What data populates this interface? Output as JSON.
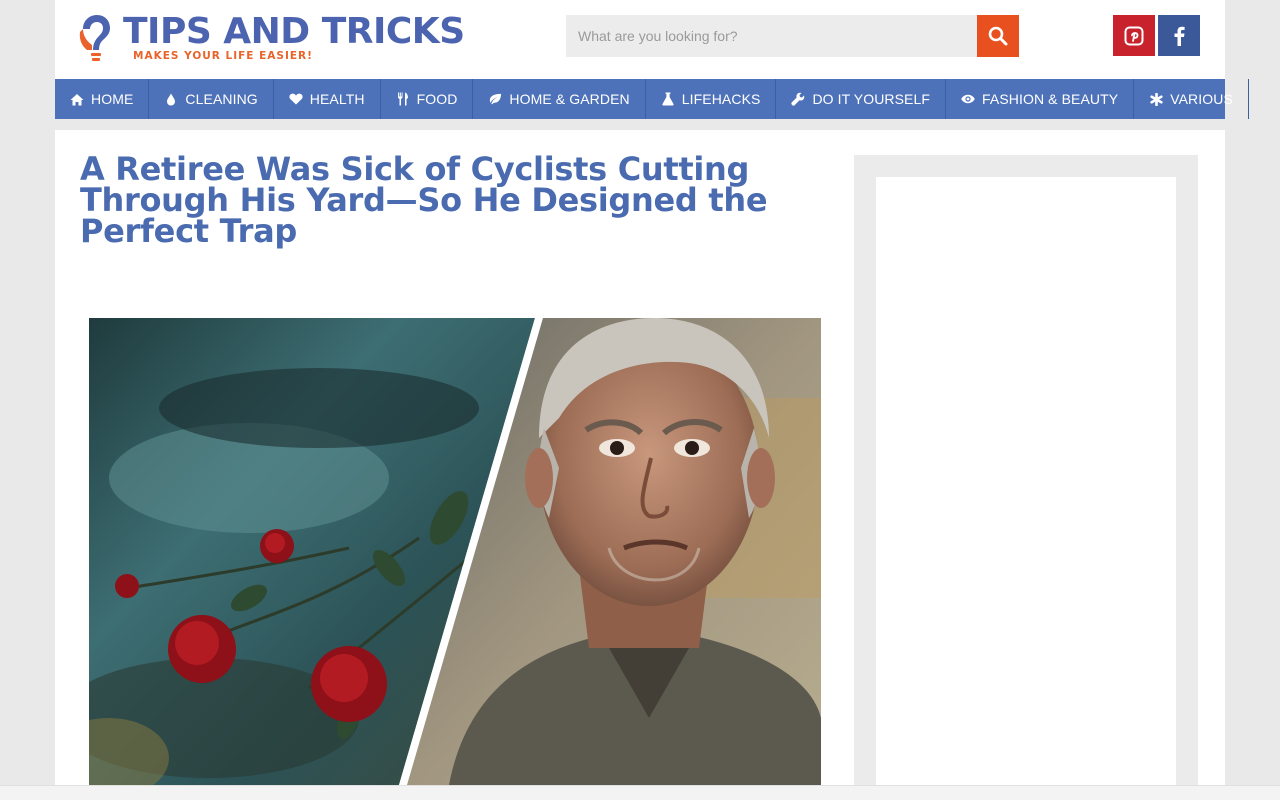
{
  "logo": {
    "title": "TIPS AND TRICKS",
    "tagline": "MAKES YOUR LIFE EASIER!"
  },
  "search": {
    "placeholder": "What are you looking for?"
  },
  "social": [
    {
      "name": "pinterest-icon"
    },
    {
      "name": "facebook-icon"
    }
  ],
  "nav": {
    "items": [
      {
        "label": "HOME",
        "icon": "home-icon"
      },
      {
        "label": "CLEANING",
        "icon": "drop-icon"
      },
      {
        "label": "HEALTH",
        "icon": "heart-icon"
      },
      {
        "label": "FOOD",
        "icon": "cutlery-icon"
      },
      {
        "label": "HOME & GARDEN",
        "icon": "leaf-icon"
      },
      {
        "label": "LIFEHACKS",
        "icon": "flask-icon"
      },
      {
        "label": "DO IT YOURSELF",
        "icon": "wrench-icon"
      },
      {
        "label": "FASHION & BEAUTY",
        "icon": "eye-icon"
      },
      {
        "label": "VARIOUS",
        "icon": "asterisk-icon"
      }
    ]
  },
  "article": {
    "title": "A Retiree Was Sick of Cyclists Cutting Through His Yard—So He Designed the Perfect Trap"
  },
  "colors": {
    "brand_blue": "#4c63b0",
    "nav_blue": "#4e72b9",
    "accent_orange": "#e8511f",
    "pinterest_red": "#c8232c",
    "facebook_blue": "#3b5998"
  }
}
